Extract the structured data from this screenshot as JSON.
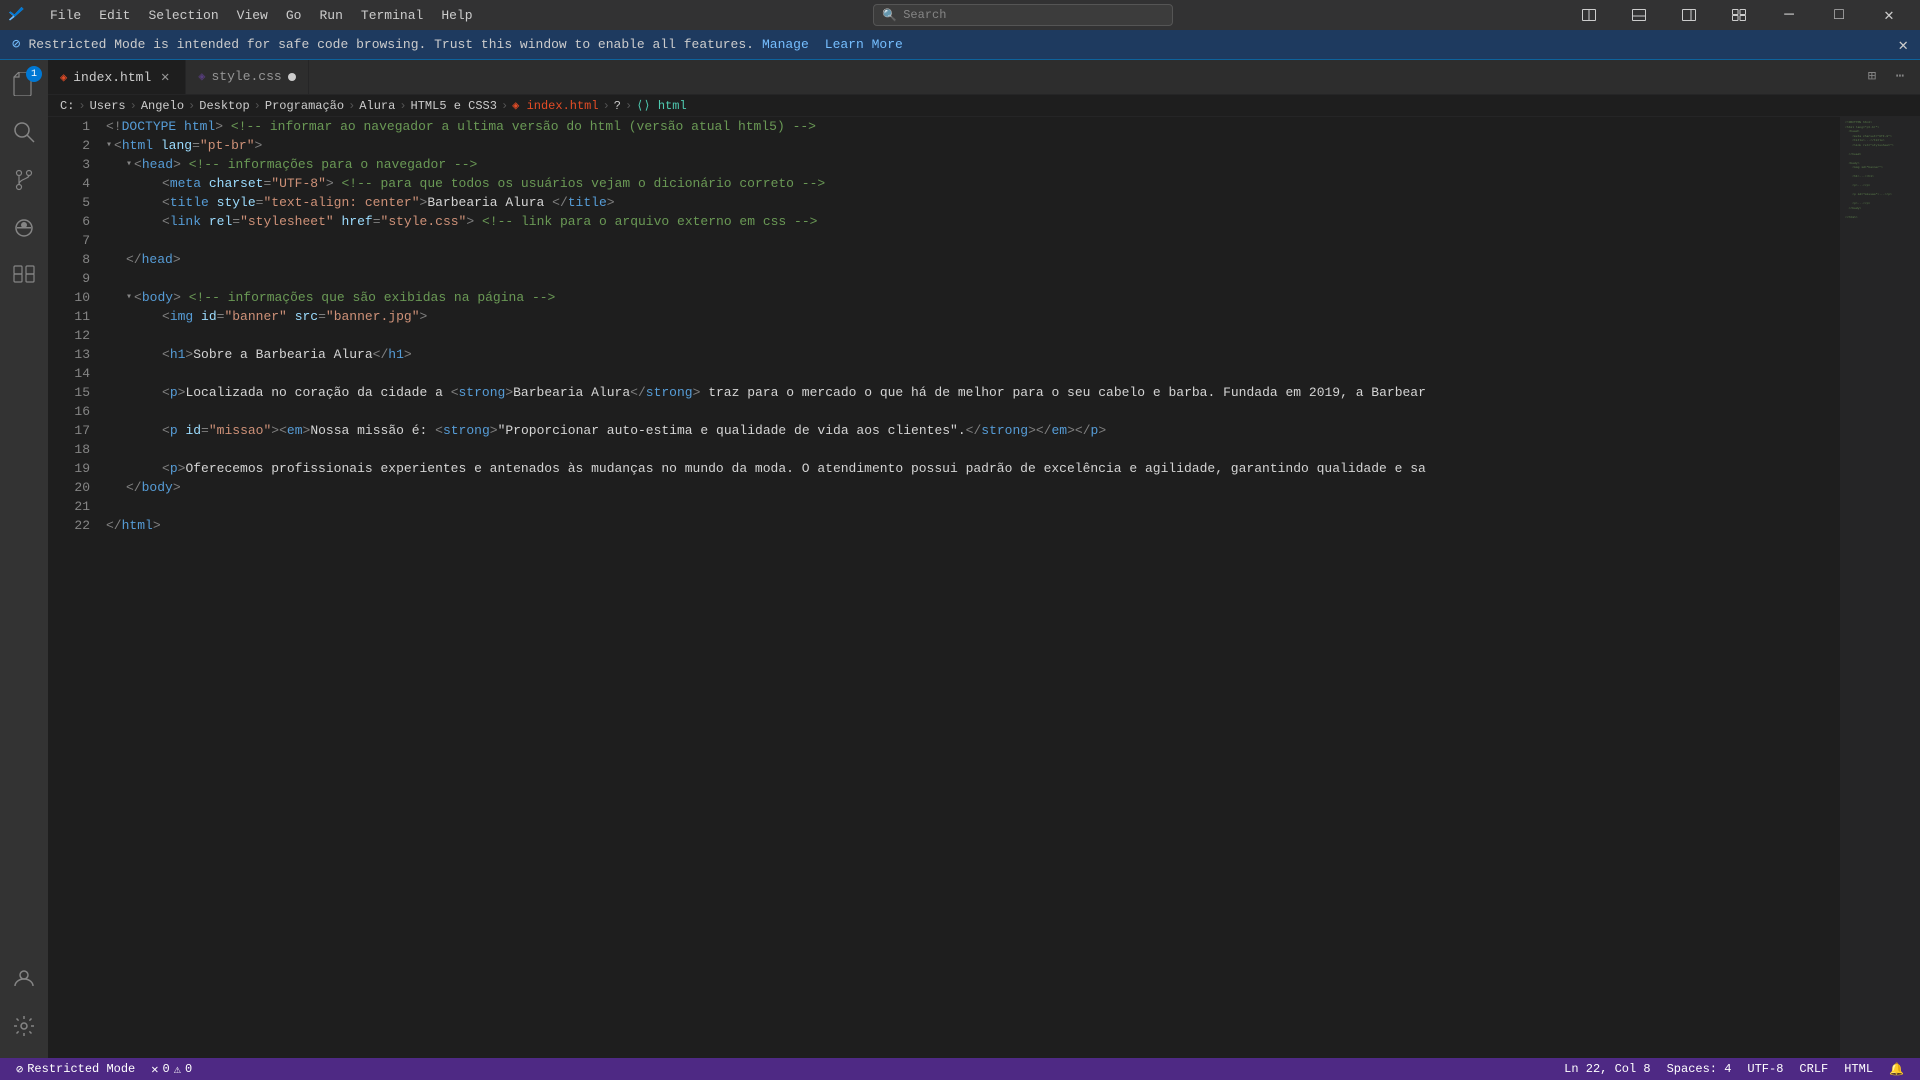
{
  "titlebar": {
    "logo": "⟨⟩",
    "menu_items": [
      "File",
      "Edit",
      "Selection",
      "View",
      "Go",
      "Run",
      "Terminal",
      "Help"
    ],
    "search_placeholder": "Search",
    "window_buttons": {
      "minimize": "─",
      "maximize": "□",
      "restore": "⧉",
      "layout": "⊞",
      "close": "✕"
    }
  },
  "banner": {
    "icon": "⊘",
    "message": "Restricted Mode is intended for safe code browsing. Trust this window to enable all features.",
    "manage_label": "Manage",
    "learn_more_label": "Learn More",
    "close": "✕"
  },
  "tabs": [
    {
      "id": "index-html",
      "icon": "html",
      "label": "index.html",
      "active": true,
      "has_close": true
    },
    {
      "id": "style-css",
      "icon": "css",
      "label": "style.css",
      "active": false,
      "has_dot": true
    }
  ],
  "tabs_actions": [
    "⊞",
    "⋯"
  ],
  "breadcrumb": [
    "C:",
    "Users",
    "Angelo",
    "Desktop",
    "Programação",
    "Alura",
    "HTML5 e CSS3",
    "index.html",
    "?",
    "html"
  ],
  "code_lines": [
    {
      "num": 1,
      "content": "<!DOCTYPE html> <!-- informar ao navegador a ultima versão do html (versão atual html5) -->"
    },
    {
      "num": 2,
      "content": "<html lang=\"pt-br\">"
    },
    {
      "num": 3,
      "content": "    <head> <!-- informações para o navegador -->"
    },
    {
      "num": 4,
      "content": "        <meta charset=\"UTF-8\"> <!-- para que todos os usuários vejam o dicionário correto -->"
    },
    {
      "num": 5,
      "content": "        <title style=\"text-align: center\">Barbearia Alura </title>"
    },
    {
      "num": 6,
      "content": "        <link rel=\"stylesheet\" href=\"style.css\"> <!-- link para o arquivo externo em css -->"
    },
    {
      "num": 7,
      "content": ""
    },
    {
      "num": 8,
      "content": "    </head>"
    },
    {
      "num": 9,
      "content": ""
    },
    {
      "num": 10,
      "content": "    <body> <!-- informações que são exibidas na página -->"
    },
    {
      "num": 11,
      "content": "        <img id=\"banner\" src=\"banner.jpg\">"
    },
    {
      "num": 12,
      "content": ""
    },
    {
      "num": 13,
      "content": "        <h1>Sobre a Barbearia Alura</h1>"
    },
    {
      "num": 14,
      "content": ""
    },
    {
      "num": 15,
      "content": "        <p>Localizada no coração da cidade a <strong>Barbearia Alura</strong> traz para o mercado o que há de melhor para o seu cabelo e barba. Fundada em 2019, a Barbear"
    },
    {
      "num": 16,
      "content": ""
    },
    {
      "num": 17,
      "content": "        <p id=\"missao\"><em>Nossa missão é: <strong>\"Proporcionar auto-estima e qualidade de vida aos clientes\".</strong></em></p>"
    },
    {
      "num": 18,
      "content": ""
    },
    {
      "num": 19,
      "content": "        <p>Oferecemos profissionais experientes e antenados às mudanças no mundo da moda. O atendimento possui padrão de excelência e agilidade, garantindo qualidade e sa"
    },
    {
      "num": 20,
      "content": "    </body>"
    },
    {
      "num": 21,
      "content": ""
    },
    {
      "num": 22,
      "content": "</html>"
    }
  ],
  "status_bar": {
    "restricted_mode": "Restricted Mode",
    "errors": "0",
    "warnings": "0",
    "line": "Ln 22, Col 8",
    "spaces": "Spaces: 4",
    "encoding": "UTF-8",
    "line_ending": "CRLF",
    "language": "HTML",
    "notifications": "🔔",
    "feedback": "☺"
  },
  "activity_bar": {
    "items": [
      {
        "id": "explorer",
        "icon": "📄",
        "badge": "1",
        "active": false
      },
      {
        "id": "search",
        "icon": "🔍",
        "active": false
      },
      {
        "id": "source-control",
        "icon": "⑂",
        "active": false
      },
      {
        "id": "debug",
        "icon": "▷",
        "active": false
      },
      {
        "id": "extensions",
        "icon": "⊞",
        "active": false
      }
    ],
    "bottom_items": [
      {
        "id": "account",
        "icon": "👤"
      },
      {
        "id": "settings",
        "icon": "⚙"
      }
    ]
  }
}
